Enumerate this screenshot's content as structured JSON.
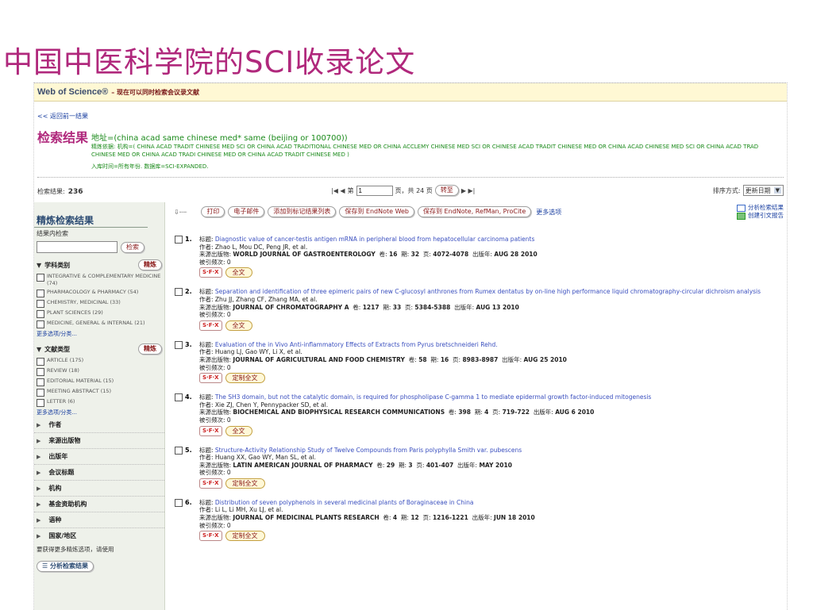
{
  "slide": {
    "title": "中国中医科学院的SCI收录论文"
  },
  "wos": {
    "brand": "Web of Science®",
    "sub": "– 现在可以同时检索会议录文献",
    "back": "<< 返回前一结果",
    "results_title": "检索结果",
    "query": "地址=(china acad same chinese med* same (beijing or 100700))",
    "refine": "精炼依据: 机构=( CHINA ACAD TRADIT CHINESE MED SCI OR CHINA ACAD TRADITIONAL CHINESE MED OR CHINA ACCLEMY CHINESE MED SCI OR CHINESE ACAD TRADIT CHINESE MED OR CHINA ACAD CHINESE MED SCI OR CHINA ACAD TRAD CHINESE MED OR CHINA ACAD TRADI CHINESE MED OR CHINA ACAD TRADIT CHINESE MED )",
    "timespan": "入库时间=所有年份. 数据库=SCI-EXPANDED.",
    "count_label": "检索结果:",
    "count": "236",
    "pager": {
      "first_prev": "|◀ ◀",
      "page_prefix": "第",
      "page_value": "1",
      "page_suffix": "页，共 24 页",
      "go": "转至",
      "next_last": "▶ ▶|"
    },
    "sort": {
      "label": "排序方式:",
      "value": "更新日期",
      "arrow": "▼"
    }
  },
  "sidebar": {
    "title": "精炼检索结果",
    "within_label": "结果内检索",
    "search_btn": "检索",
    "subject": {
      "title": "学科类别",
      "btn": "精炼",
      "items": [
        "INTEGRATIVE & COMPLEMENTARY MEDICINE (74)",
        "PHARMACOLOGY & PHARMACY (54)",
        "CHEMISTRY, MEDICINAL (33)",
        "PLANT SCIENCES (29)",
        "MEDICINE, GENERAL & INTERNAL (21)"
      ],
      "more": "更多选项/分类..."
    },
    "doctype": {
      "title": "文献类型",
      "btn": "精炼",
      "items": [
        "ARTICLE (175)",
        "REVIEW (18)",
        "EDITORIAL MATERIAL (15)",
        "MEETING ABSTRACT (15)",
        "LETTER (6)"
      ],
      "more": "更多选项/分类..."
    },
    "collapsed": [
      "作者",
      "来源出版物",
      "出版年",
      "会议标题",
      "机构",
      "基金资助机构",
      "语种",
      "国家/地区"
    ],
    "note": "要获得更多精炼选项，请使用",
    "analyze_btn": "☰ 分析检索结果"
  },
  "toolbar": {
    "print": "打印",
    "email": "电子邮件",
    "add_marked": "添加到标记结果列表",
    "save_endnote_web": "保存到 EndNote Web",
    "save_endnote": "保存到 EndNote, RefMan, ProCite",
    "more": "更多选项"
  },
  "right_links": {
    "analyze": "分析检索结果",
    "citation_report": "创建引文报告"
  },
  "labels": {
    "title": "标题:",
    "authors": "作者:",
    "source": "来源出版物:",
    "vol": "卷:",
    "issue": "期:",
    "pages": "页:",
    "date": "出版年:",
    "cited": "被引频次:",
    "sfx": "S·F·X"
  },
  "records": [
    {
      "num": "1.",
      "title": "Diagnostic value of cancer-testis antigen mRNA in peripheral blood from hepatocellular carcinoma patients",
      "authors": "Zhao L, Mou DC, Peng JR, et al.",
      "source": "WORLD JOURNAL OF GASTROENTEROLOGY",
      "vol": "16",
      "issue": "32",
      "pages": "4072-4078",
      "date": "AUG 28 2010",
      "cited": "0",
      "fulltext": "全文"
    },
    {
      "num": "2.",
      "title": "Separation and identification of three epimeric pairs of new C-glucosyl anthrones from Rumex dentatus by on-line high performance liquid chromatography-circular dichroism analysis",
      "authors": "Zhu JJ, Zhang CF, Zhang MA, et al.",
      "source": "JOURNAL OF CHROMATOGRAPHY A",
      "vol": "1217",
      "issue": "33",
      "pages": "5384-5388",
      "date": "AUG 13 2010",
      "cited": "0",
      "fulltext": "全文"
    },
    {
      "num": "3.",
      "title": "Evaluation of the in Vivo Anti-inflammatory Effects of Extracts from Pyrus bretschneideri Rehd.",
      "authors": "Huang LJ, Gao WY, Li X, et al.",
      "source": "JOURNAL OF AGRICULTURAL AND FOOD CHEMISTRY",
      "vol": "58",
      "issue": "16",
      "pages": "8983-8987",
      "date": "AUG 25 2010",
      "cited": "0",
      "fulltext": "定制全文"
    },
    {
      "num": "4.",
      "title": "The SH3 domain, but not the catalytic domain, is required for phospholipase C-gamma 1 to mediate epidermal growth factor-induced mitogenesis",
      "authors": "Xie ZJ, Chen Y, Pennypacker SD, et al.",
      "source": "BIOCHEMICAL AND BIOPHYSICAL RESEARCH COMMUNICATIONS",
      "vol": "398",
      "issue": "4",
      "pages": "719-722",
      "date": "AUG 6 2010",
      "cited": "0",
      "fulltext": "全文"
    },
    {
      "num": "5.",
      "title": "Structure-Activity Relationship Study of Twelve Compounds from Paris polyphylla Smith var. pubescens",
      "authors": "Huang XX, Gao WY, Man SL, et al.",
      "source": "LATIN AMERICAN JOURNAL OF PHARMACY",
      "vol": "29",
      "issue": "3",
      "pages": "401-407",
      "date": "MAY 2010",
      "cited": "0",
      "fulltext": "定制全文"
    },
    {
      "num": "6.",
      "title": "Distribution of seven polyphenols in several medicinal plants of Boraginaceae in China",
      "authors": "Li L, Li MH, Xu LJ, et al.",
      "source": "JOURNAL OF MEDICINAL PLANTS RESEARCH",
      "vol": "4",
      "issue": "12",
      "pages": "1216-1221",
      "date": "JUN 18 2010",
      "cited": "0",
      "fulltext": "定制全文"
    }
  ]
}
